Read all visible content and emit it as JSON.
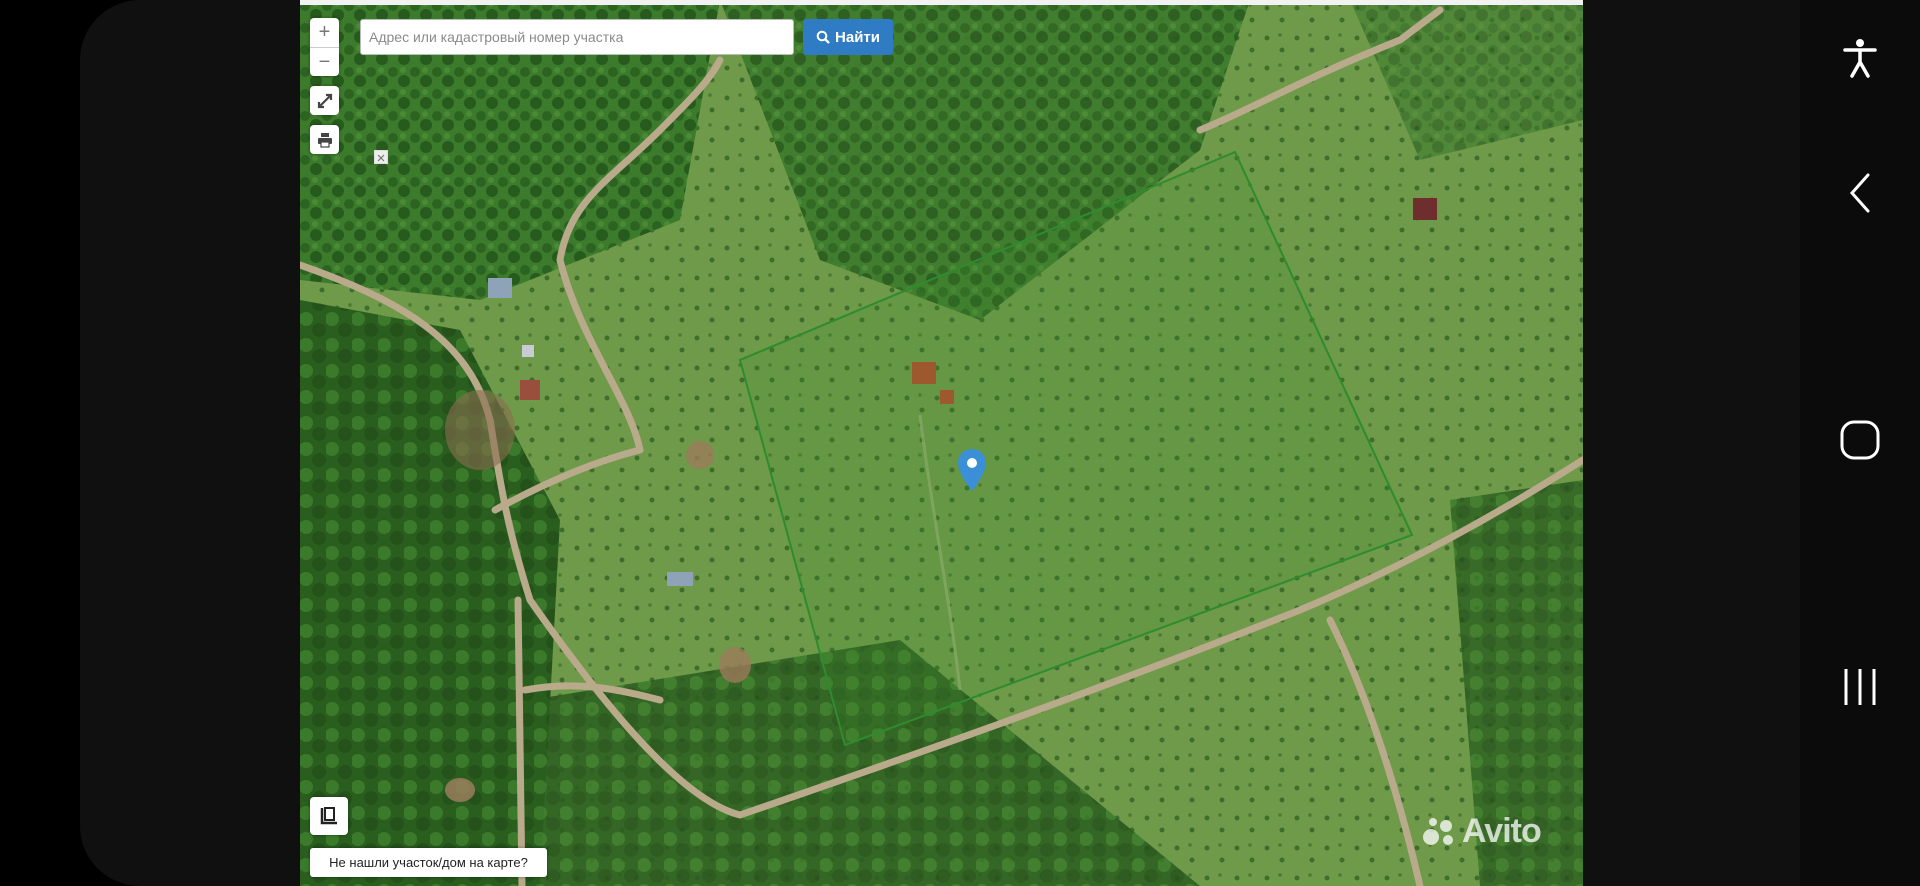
{
  "map": {
    "search_placeholder": "Адрес или кадастровый номер участка",
    "search_value": "",
    "find_label": "Найти",
    "zoom_in_label": "+",
    "zoom_out_label": "−",
    "not_found_label": "Не нашли участок/дом на карте?",
    "watermark": "Avito",
    "parcel_color": "#2e8b2e",
    "marker_color": "#3a8fd6"
  },
  "system_nav": {
    "items": [
      "accessibility-icon",
      "back-icon",
      "home-icon",
      "recents-icon"
    ]
  }
}
